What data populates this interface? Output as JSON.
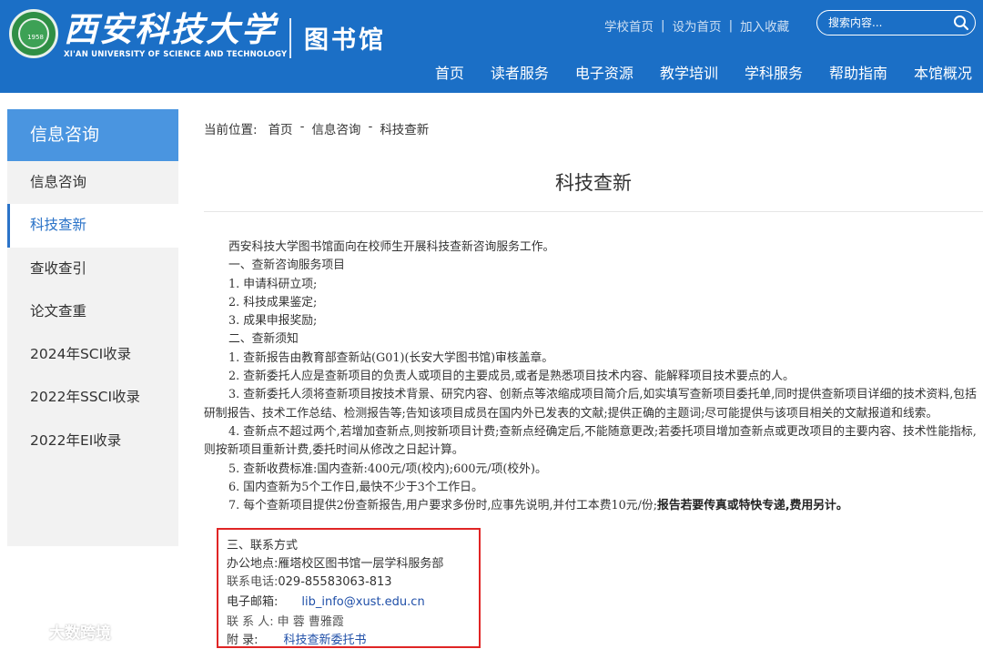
{
  "header": {
    "uni_name": "西安科技大学",
    "uni_en": "XI'AN UNIVERSITY OF SCIENCE AND TECHNOLOGY",
    "seal_year": "1958",
    "lib_name": "图书馆",
    "toplinks": [
      "学校首页",
      "设为首页",
      "加入收藏"
    ],
    "search_placeholder": "搜索内容...",
    "nav": [
      "首页",
      "读者服务",
      "电子资源",
      "教学培训",
      "学科服务",
      "帮助指南",
      "本馆概况"
    ],
    "brand_color": "#1b6fc6"
  },
  "sidebar": {
    "title": "信息咨询",
    "items": [
      {
        "label": "信息咨询",
        "active": false
      },
      {
        "label": "科技查新",
        "active": true
      },
      {
        "label": "查收查引",
        "active": false
      },
      {
        "label": "论文查重",
        "active": false
      },
      {
        "label": "2024年SCI收录",
        "active": false
      },
      {
        "label": "2022年SSCI收录",
        "active": false
      },
      {
        "label": "2022年EI收录",
        "active": false
      }
    ]
  },
  "breadcrumb": {
    "prefix": "当前位置:",
    "items": [
      "首页",
      "信息咨询",
      "科技查新"
    ],
    "separator": "-"
  },
  "page_title": "科技查新",
  "article": {
    "intro": "西安科技大学图书馆面向在校师生开展科技查新咨询服务工作。",
    "s1_heading": "一、查新咨询服务项目",
    "s1_items": [
      "1. 申请科研立项;",
      "2. 科技成果鉴定;",
      "3. 成果申报奖励;"
    ],
    "s2_heading": "二、查新须知",
    "s2_1": "1. 查新报告由教育部查新站(G01)(长安大学图书馆)审核盖章。",
    "s2_2": "2. 查新委托人应是查新项目的负责人或项目的主要成员,或者是熟悉项目技术内容、能解释项目技术要点的人。",
    "s2_3": "3. 查新委托人须将查新项目按技术背景、研究内容、创新点等浓缩成项目简介后,如实填写查新项目委托单,同时提供查新项目详细的技术资料,包括研制报告、技术工作总结、检测报告等;告知该项目成员在国内外已发表的文献;提供正确的主题词;尽可能提供与该项目相关的文献报道和线索。",
    "s2_4": "4. 查新点不超过两个,若增加查新点,则按新项目计费;查新点经确定后,不能随意更改;若委托项目增加查新点或更改项目的主要内容、技术性能指标,则按新项目重新计费,委托时间从修改之日起计算。",
    "s2_5": "5. 查新收费标准:国内查新:400元/项(校内);600元/项(校外)。",
    "s2_6": "6. 国内查新为5个工作日,最快不少于3个工作日。",
    "s2_7a": "7. 每个查新项目提供2份查新报告,用户要求多份时,应事先说明,并付工本费10元/份;",
    "s2_7b": "报告若要传真或特快专递,费用另计。"
  },
  "contact": {
    "heading": "三、联系方式",
    "office_label": "办公地点:",
    "office_value": "雁塔校区图书馆一层学科服务部",
    "phone_label": "联系电话:",
    "phone_value": "029-85583063-813",
    "email_label": "电子邮箱:",
    "email_value": "lib_info@xust.edu.cn",
    "person_label": "联 系 人:",
    "person_value": "申 蓉 曹雅霞",
    "attach_label": "附 录:",
    "attach_value": "科技查新委托书",
    "highlight_color": "#e02525"
  },
  "watermark": "大数跨境"
}
